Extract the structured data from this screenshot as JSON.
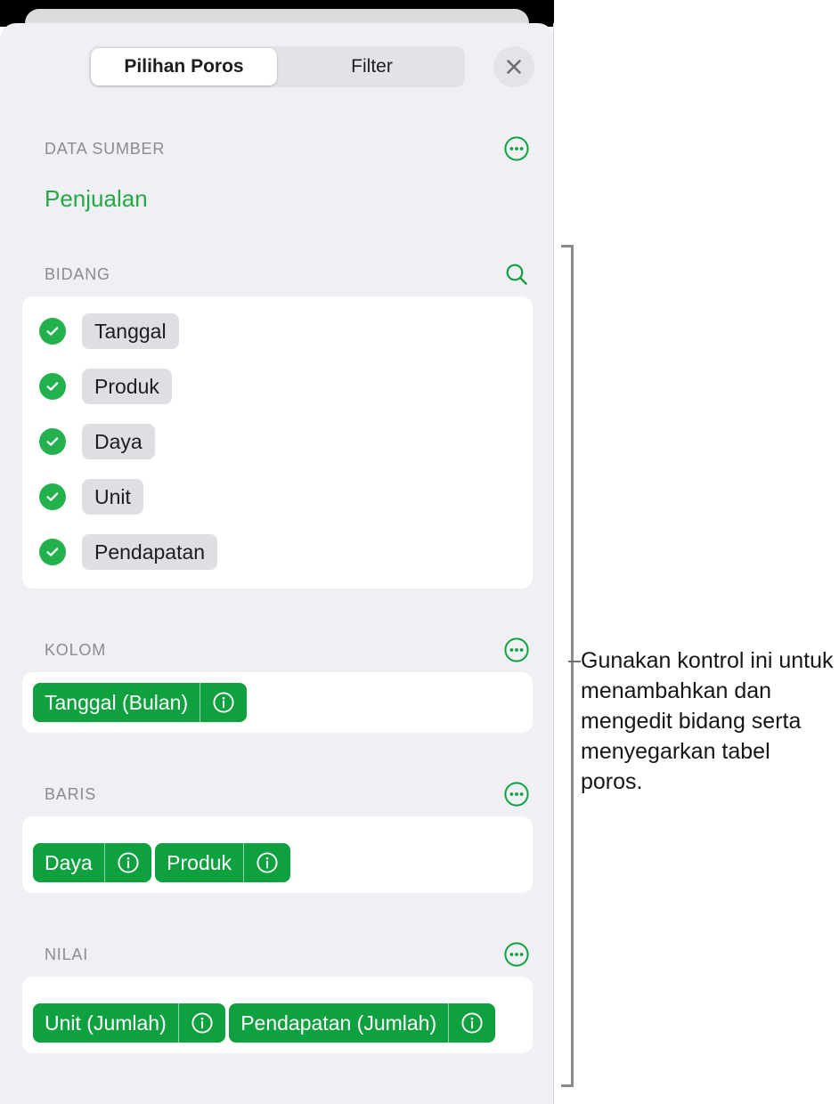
{
  "window": {
    "title": "Pivot Options popover"
  },
  "header": {
    "tabs": [
      {
        "label": "Pilihan Poros",
        "active": true
      },
      {
        "label": "Filter",
        "active": false
      }
    ],
    "close_icon": "close-icon"
  },
  "sections": {
    "data_source": {
      "title": "DATA SUMBER",
      "more_icon": "ellipsis-circle-icon",
      "value": "Penjualan"
    },
    "fields": {
      "title": "BIDANG",
      "search_icon": "search-icon",
      "items": [
        {
          "label": "Tanggal",
          "checked": true
        },
        {
          "label": "Produk",
          "checked": true
        },
        {
          "label": "Daya",
          "checked": true
        },
        {
          "label": "Unit",
          "checked": true
        },
        {
          "label": "Pendapatan",
          "checked": true
        }
      ]
    },
    "columns": {
      "title": "KOLOM",
      "more_icon": "ellipsis-circle-icon",
      "chips": [
        {
          "label": "Tanggal (Bulan)",
          "info_icon": "info-circle-icon"
        }
      ]
    },
    "rows": {
      "title": "BARIS",
      "more_icon": "ellipsis-circle-icon",
      "chips": [
        {
          "label": "Daya",
          "info_icon": "info-circle-icon"
        },
        {
          "label": "Produk",
          "info_icon": "info-circle-icon"
        }
      ]
    },
    "values": {
      "title": "NILAI",
      "more_icon": "ellipsis-circle-icon",
      "chips": [
        {
          "label": "Unit (Jumlah)",
          "info_icon": "info-circle-icon"
        },
        {
          "label": "Pendapatan (Jumlah)",
          "info_icon": "info-circle-icon"
        }
      ]
    }
  },
  "callout": {
    "text": "Gunakan kontrol ini untuk menambahkan dan mengedit bidang serta menyegarkan tabel poros."
  },
  "colors": {
    "accent_green": "#0fa03f",
    "check_green": "#22b14c",
    "source_text_green": "#27a745",
    "panel_bg": "#eff0f4",
    "card_bg": "#ffffff",
    "pill_bg": "#dfdfe3",
    "section_title": "#8b8b90",
    "bracket": "#8b8b8f"
  }
}
